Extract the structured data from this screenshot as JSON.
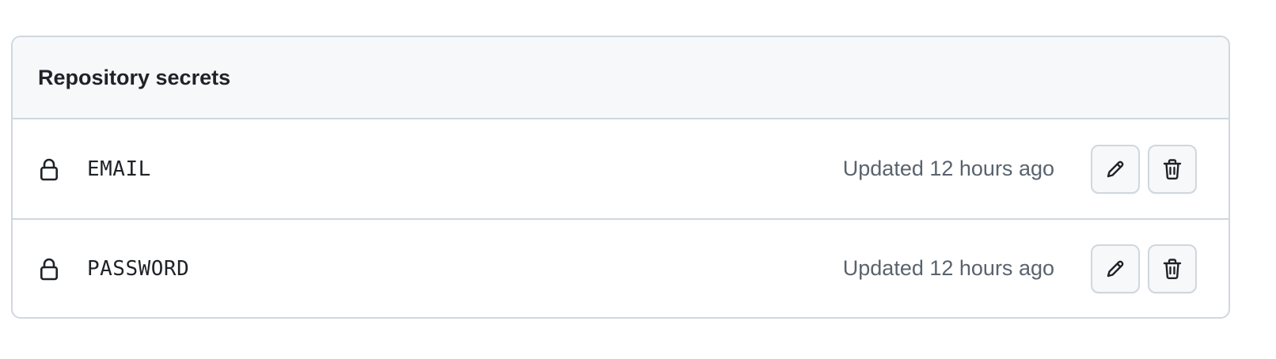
{
  "section": {
    "title": "Repository secrets"
  },
  "secrets": [
    {
      "name": "EMAIL",
      "updated": "Updated 12 hours ago",
      "icon": "lock-icon"
    },
    {
      "name": "PASSWORD",
      "updated": "Updated 12 hours ago",
      "icon": "lock-icon"
    }
  ],
  "actions": {
    "edit_icon": "pencil-icon",
    "delete_icon": "trash-icon"
  },
  "colors": {
    "header_bg": "#f6f8fa",
    "border": "#d0d7de",
    "text": "#1f2328",
    "muted_text": "#59636e"
  }
}
